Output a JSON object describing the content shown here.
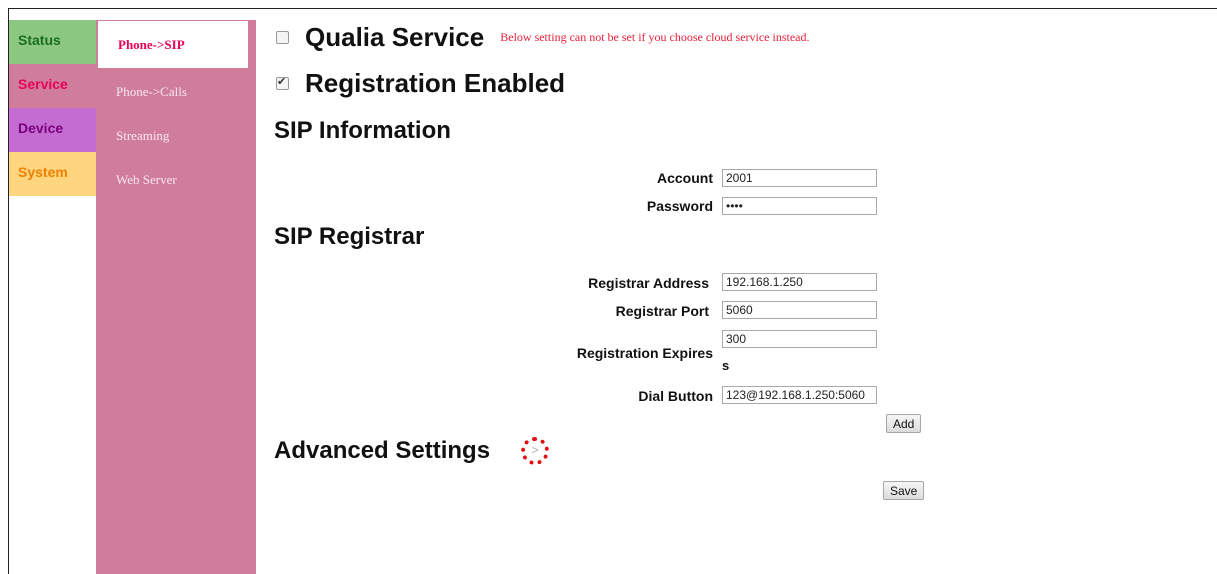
{
  "main_nav": {
    "status": "Status",
    "service": "Service",
    "device": "Device",
    "system": "System"
  },
  "sub_nav": {
    "items": [
      "Phone->SIP",
      "Phone->Calls",
      "Streaming",
      "Web Server"
    ]
  },
  "qualia": {
    "label": "Qualia Service",
    "note": "Below setting can not be set if you choose cloud service instead.",
    "checked": false
  },
  "registration": {
    "label": "Registration Enabled",
    "checked": true
  },
  "sip_info": {
    "title": "SIP Information",
    "account_label": "Account",
    "account_value": "2001",
    "password_label": "Password",
    "password_value": "••••"
  },
  "sip_registrar": {
    "title": "SIP Registrar",
    "address_label": "Registrar Address",
    "address_value": "192.168.1.250",
    "port_label": "Registrar Port",
    "port_value": "5060",
    "expires_label": "Registration Expires",
    "expires_value": "300",
    "expires_unit": "s",
    "dial_label": "Dial Button",
    "dial_value": "123@192.168.1.250:5060",
    "add_label": "Add"
  },
  "advanced": {
    "title": "Advanced Settings",
    "expand_glyph": ">"
  },
  "save_label": "Save",
  "colors": {
    "status_tab": "#8dc883",
    "service_tab": "#d07d9b",
    "device_tab": "#c46cd2",
    "system_tab": "#ffd57f",
    "sub_nav_bg": "#d07d9b",
    "note_text": "#e8203a",
    "expand_ring": "#e01010"
  }
}
